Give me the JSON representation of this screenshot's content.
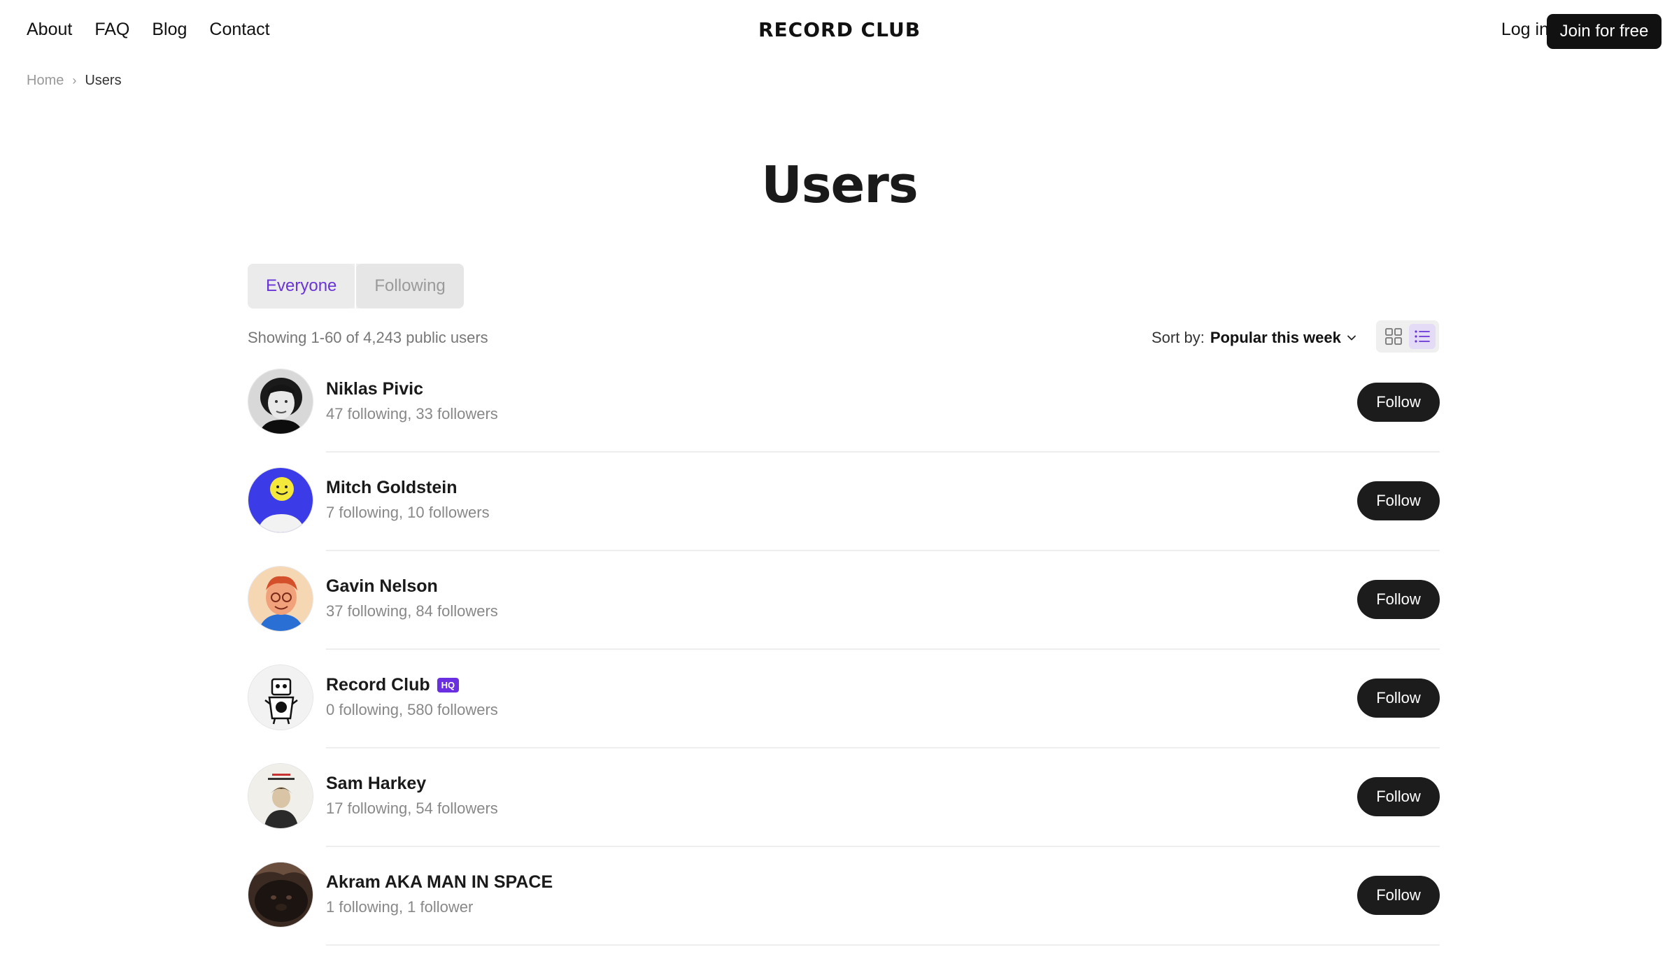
{
  "nav": {
    "links": [
      "About",
      "FAQ",
      "Blog",
      "Contact"
    ],
    "logo": "RECORD CLUB",
    "login": "Log in",
    "join": "Join for free"
  },
  "breadcrumb": {
    "home": "Home",
    "current": "Users"
  },
  "title": "Users",
  "tabs": [
    {
      "label": "Everyone",
      "active": true
    },
    {
      "label": "Following",
      "active": false
    }
  ],
  "showing_text": "Showing 1-60 of 4,243 public users",
  "sort": {
    "label": "Sort by:",
    "value": "Popular this week"
  },
  "view_toggle": {
    "selected": "list"
  },
  "users": [
    {
      "name": "Niklas Pivic",
      "stats": "47 following, 33 followers",
      "badge": "",
      "follow_label": "Follow",
      "avatar": "portrait-bw"
    },
    {
      "name": "Mitch Goldstein",
      "stats": "7 following, 10 followers",
      "badge": "",
      "follow_label": "Follow",
      "avatar": "smiley-blue"
    },
    {
      "name": "Gavin Nelson",
      "stats": "37 following, 84 followers",
      "badge": "",
      "follow_label": "Follow",
      "avatar": "cartoon-redhead"
    },
    {
      "name": "Record Club",
      "stats": "0 following, 580 followers",
      "badge": "HQ",
      "follow_label": "Follow",
      "avatar": "record-mascot"
    },
    {
      "name": "Sam Harkey",
      "stats": "17 following, 54 followers",
      "badge": "",
      "follow_label": "Follow",
      "avatar": "poster-portrait"
    },
    {
      "name": "Akram AKA MAN IN SPACE",
      "stats": "1 following, 1 follower",
      "badge": "",
      "follow_label": "Follow",
      "avatar": "dark-animal"
    }
  ],
  "colors": {
    "accent": "#6a35d6",
    "button": "#1c1c1c",
    "badge": "#6a2fe0"
  }
}
